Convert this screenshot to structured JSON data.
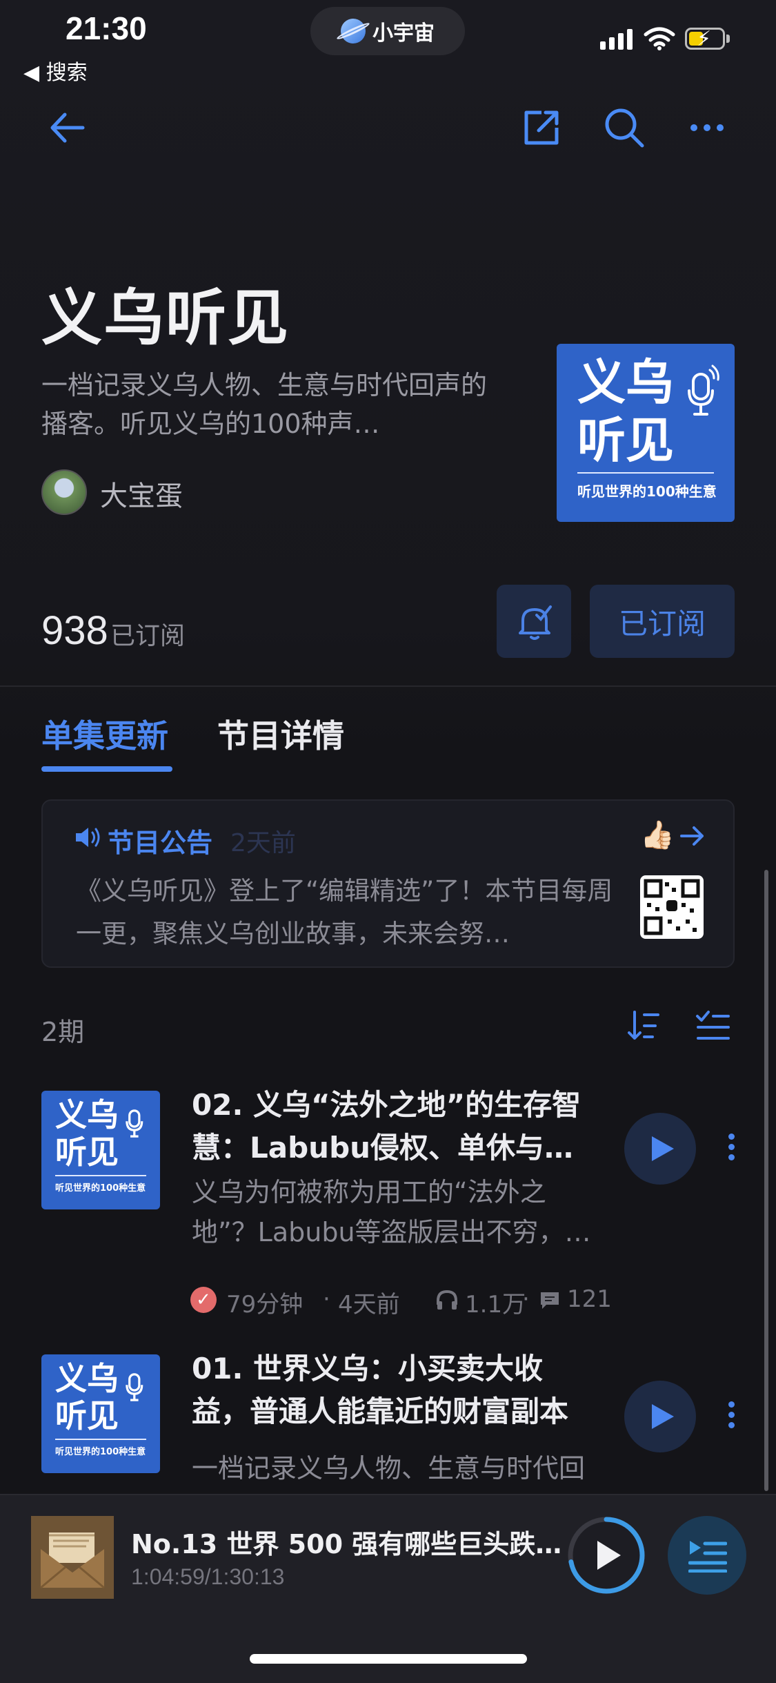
{
  "status_bar": {
    "time": "21:30",
    "back_label": "◀ 搜索",
    "island_label": "小宇宙"
  },
  "nav": {
    "back_icon": "arrow-left-icon",
    "share_icon": "share-icon",
    "search_icon": "search-icon",
    "more_icon": "more-icon"
  },
  "podcast": {
    "title": "义乌听见",
    "description": "一档记录义乌人物、生意与时代回声的播客。听见义乌的100种声…",
    "author": "大宝蛋",
    "cover_title_line1": "义乌",
    "cover_title_line2": "听见",
    "cover_subtitle": "听见世界的100种生意",
    "subscriber_count": "938",
    "subscriber_label": "已订阅",
    "subscribe_button": "已订阅"
  },
  "tabs": [
    {
      "label": "单集更新",
      "active": true
    },
    {
      "label": "节目详情",
      "active": false
    }
  ],
  "announcement": {
    "title": "节目公告",
    "time": "2天前",
    "body": "《义乌听见》登上了“编辑精选”了！本节目每周一更，聚焦义乌创业故事，未来会努…",
    "emoji": "👍🏻"
  },
  "episode_count": "2期",
  "episodes": [
    {
      "title": "02. 义乌“法外之地”的生存智慧：Labubu侵权、单休与…",
      "description": "义乌为何被称为用工的“法外之地”？Labubu等盗版层出不穷，…",
      "duration": "79分钟",
      "date": "4天前",
      "plays": "1.1万",
      "comments": "121"
    },
    {
      "title": "01. 世界义乌：小买卖大收益，普通人能靠近的财富副本",
      "description": "一档记录义乌人物、生意与时代回",
      "duration": "",
      "date": "",
      "plays": "",
      "comments": ""
    }
  ],
  "player": {
    "title": "No.13 世界 500 强有哪些巨头跌…",
    "time": "1:04:59/1:30:13",
    "progress": 0.72
  },
  "colors": {
    "accent": "#4b86f0",
    "background": "#141418",
    "cover_blue": "#2f63c8",
    "button_bg": "#1f2a44"
  }
}
